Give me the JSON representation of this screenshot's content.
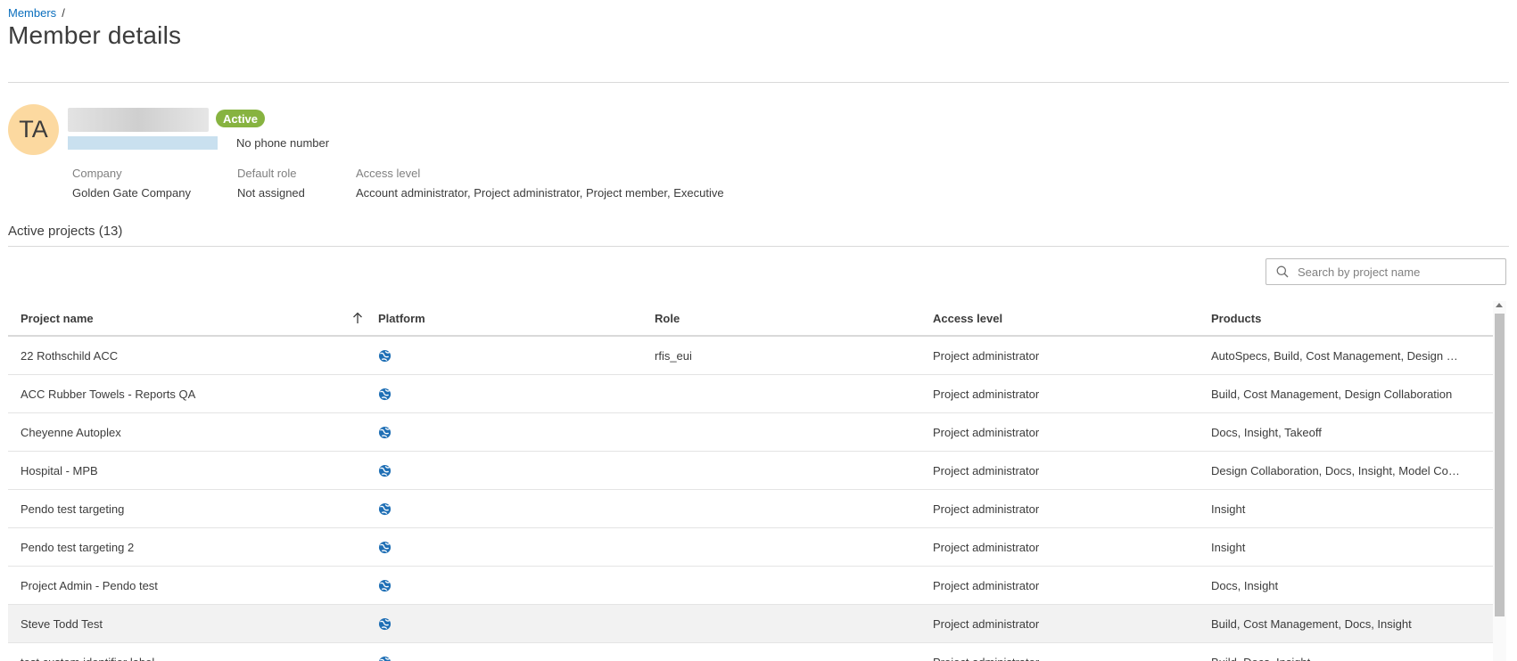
{
  "breadcrumb": {
    "parent": "Members",
    "sep": "/"
  },
  "page": {
    "title": "Member details"
  },
  "member": {
    "initials": "TA",
    "status": "Active",
    "phone": "No phone number",
    "company_label": "Company",
    "company": "Golden Gate Company",
    "default_role_label": "Default role",
    "default_role": "Not assigned",
    "access_level_label": "Access level",
    "access_level": "Account administrator, Project administrator, Project member, Executive"
  },
  "projects": {
    "title": "Active projects (13)",
    "search_placeholder": "Search by project name",
    "columns": {
      "name": "Project name",
      "platform": "Platform",
      "role": "Role",
      "access": "Access level",
      "products": "Products"
    },
    "rows": [
      {
        "name": "22 Rothschild ACC",
        "role": "rfis_eui",
        "access": "Project administrator",
        "products": "AutoSpecs, Build, Cost Management, Design Collaboration"
      },
      {
        "name": "ACC Rubber Towels - Reports QA",
        "role": "",
        "access": "Project administrator",
        "products": "Build, Cost Management, Design Collaboration"
      },
      {
        "name": "Cheyenne Autoplex",
        "role": "",
        "access": "Project administrator",
        "products": "Docs, Insight, Takeoff"
      },
      {
        "name": "Hospital - MPB",
        "role": "",
        "access": "Project administrator",
        "products": "Design Collaboration, Docs, Insight, Model Coordination"
      },
      {
        "name": "Pendo test targeting",
        "role": "",
        "access": "Project administrator",
        "products": "Insight"
      },
      {
        "name": "Pendo test targeting 2",
        "role": "",
        "access": "Project administrator",
        "products": "Insight"
      },
      {
        "name": "Project Admin - Pendo test",
        "role": "",
        "access": "Project administrator",
        "products": "Docs, Insight"
      },
      {
        "name": "Steve Todd Test",
        "role": "",
        "access": "Project administrator",
        "products": "Build, Cost Management, Docs, Insight"
      },
      {
        "name": "test custom identifier label",
        "role": "",
        "access": "Project administrator",
        "products": "Build, Docs, Insight"
      }
    ]
  },
  "icons": {
    "platform": "globe-icon",
    "sort": "arrow-up-icon",
    "search": "search-icon"
  },
  "colors": {
    "link": "#0a6ebd",
    "badge": "#87b340",
    "avatar": "#fcd9a0",
    "platform_icon": "#1f6fb5"
  }
}
